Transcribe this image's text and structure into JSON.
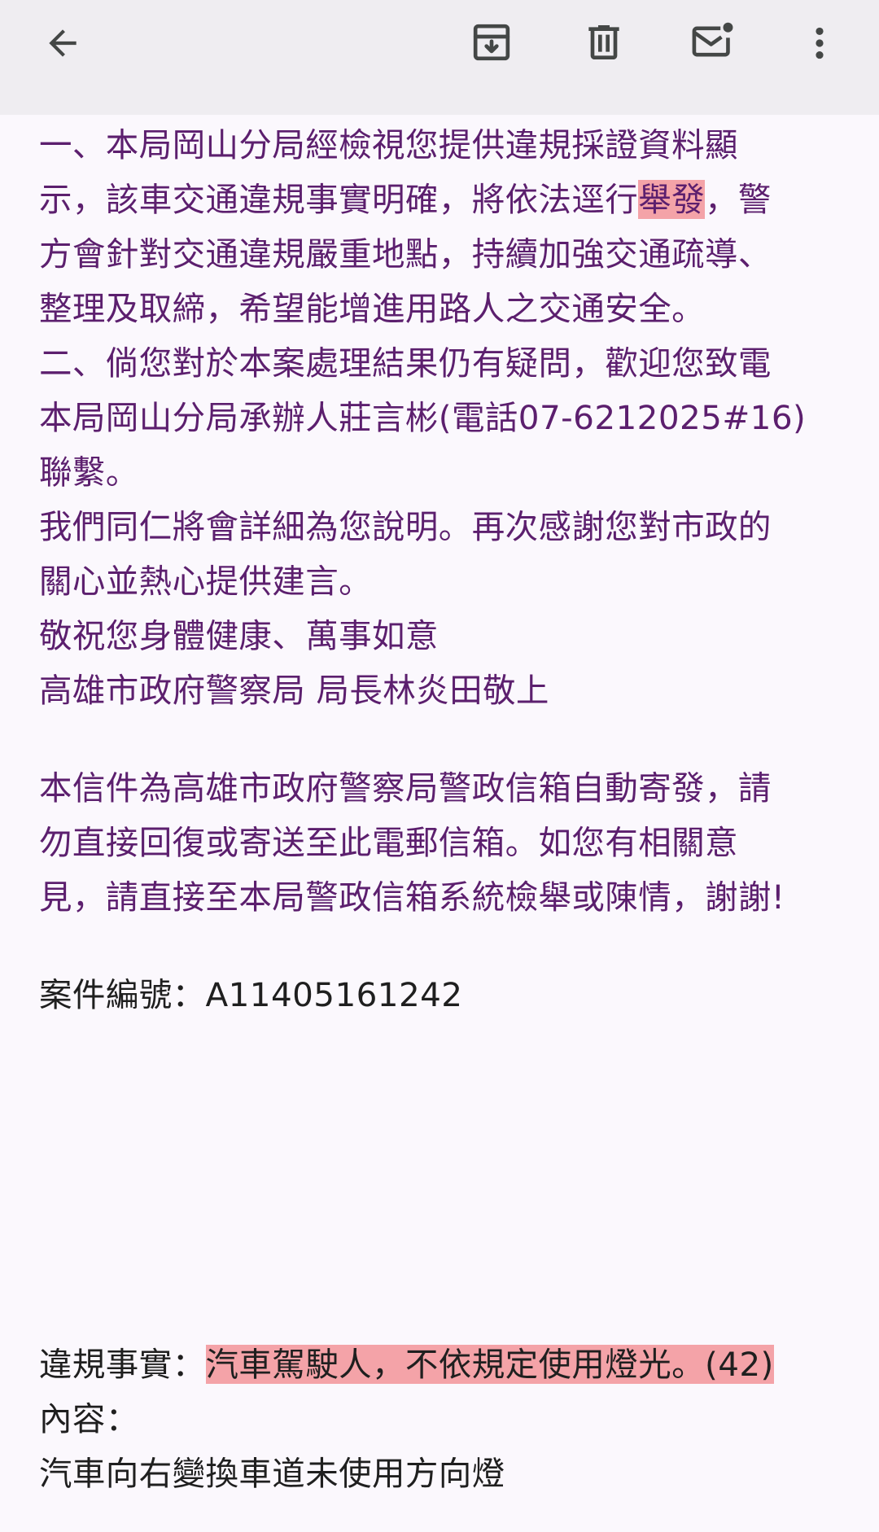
{
  "toolbar": {
    "back_icon": "arrow-left-icon",
    "archive_icon": "archive-icon",
    "delete_icon": "trash-icon",
    "mark_unread_icon": "mail-unread-icon",
    "more_icon": "more-vert-icon"
  },
  "colors": {
    "body_text": "#5c1f6e",
    "highlight": "#f4a3a8",
    "toolbar_bg": "#efedf1",
    "page_bg": "#fbf8fd"
  },
  "reply": {
    "p1_l1": "一、本局岡山分局經檢視您提供違規採證資料顯",
    "p1_l2_a": "示，該車交通違規事實明確，將依法逕行",
    "p1_l2_hl": "舉發",
    "p1_l2_b": "，警",
    "p1_l3": "方會針對交通違規嚴重地點，持續加強交通疏導、",
    "p1_l4": "整理及取締，希望能增進用路人之交通安全。",
    "p2_l1": "二、倘您對於本案處理結果仍有疑問，歡迎您致電",
    "p2_l2": "本局岡山分局承辦人莊言彬(電話07-6212025#16)",
    "p2_l3": "聯繫。",
    "p3_l1": "我們同仁將會詳細為您說明。再次感謝您對市政的",
    "p3_l2": "關心並熱心提供建言。",
    "greeting": "敬祝您身體健康、萬事如意",
    "signature": "高雄市政府警察局 局長林炎田敬上"
  },
  "notice": {
    "l1": "本信件為高雄市政府警察局警政信箱自動寄發，請",
    "l2": "勿直接回復或寄送至此電郵信箱。如您有相關意",
    "l3": "見，請直接至本局警政信箱系統檢舉或陳情，謝謝!"
  },
  "case": {
    "label": "案件編號：",
    "number": "A11405161242"
  },
  "violation": {
    "label": "違規事實：",
    "fact": "汽車駕駛人，不依規定使用燈光。(42)",
    "content_label": "內容：",
    "content": "汽車向右變換車道未使用方向燈"
  }
}
